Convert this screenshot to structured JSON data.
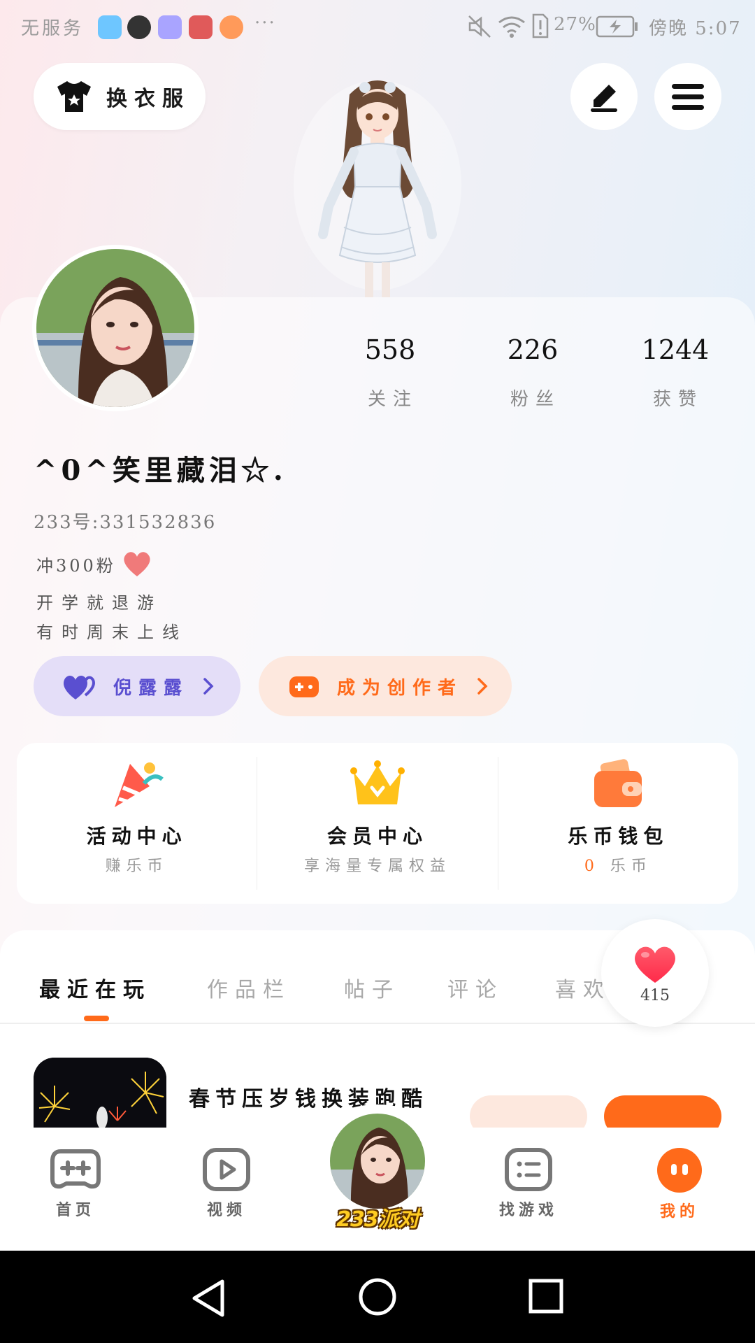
{
  "status_bar": {
    "carrier": "无服务",
    "more": "···",
    "battery": "27%",
    "time": "傍晚 5:07"
  },
  "header": {
    "change_outfit": "换衣服"
  },
  "profile": {
    "stats": [
      {
        "value": "558",
        "label": "关注"
      },
      {
        "value": "226",
        "label": "粉丝"
      },
      {
        "value": "1244",
        "label": "获赞"
      }
    ],
    "username": "^0^笑里藏泪☆.",
    "uid": "233号:331532836",
    "bio": [
      "冲300粉",
      "开学就退游",
      "有时周末上线"
    ],
    "tags": [
      {
        "label": "倪露露",
        "color": "#5a4fd0"
      },
      {
        "label": "成为创作者",
        "color": "#ff6a1a"
      }
    ]
  },
  "services": [
    {
      "title": "活动中心",
      "subtitle": "赚乐币"
    },
    {
      "title": "会员中心",
      "subtitle": "享海量专属权益"
    },
    {
      "title": "乐币钱包",
      "value": "0",
      "subtitle": "乐币"
    }
  ],
  "tabs": [
    "最近在玩",
    "作品栏",
    "帖子",
    "评论",
    "喜欢"
  ],
  "like_bubble": {
    "count": "415"
  },
  "recent_game": {
    "title": "春节压岁钱换装跑酷"
  },
  "bottom_nav": [
    {
      "label": "首页",
      "active": false
    },
    {
      "label": "视频",
      "active": false
    },
    {
      "label": "233派对",
      "active": false
    },
    {
      "label": "找游戏",
      "active": false
    },
    {
      "label": "我的",
      "active": true
    }
  ],
  "colors": {
    "accent": "#ff6a1a",
    "purple": "#5a4fd0",
    "heart": "#ff3d5a"
  }
}
